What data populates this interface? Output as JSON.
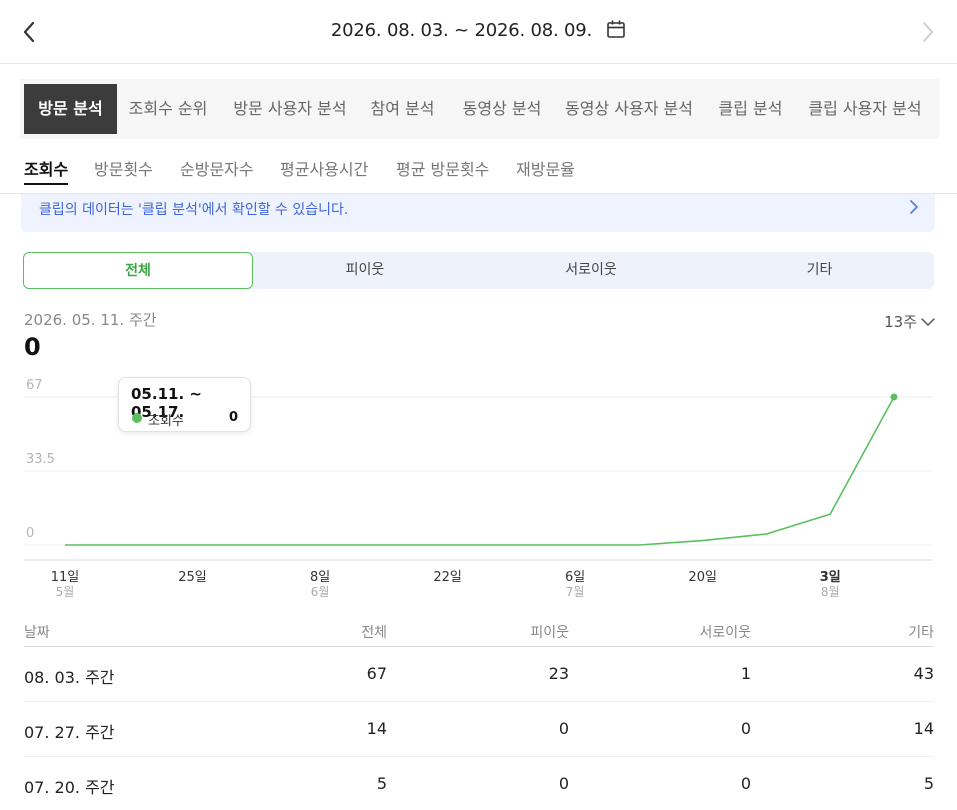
{
  "header": {
    "date_range": "2026. 08. 03. ~ 2026. 08. 09.",
    "icons": {
      "back": "chevron-left-icon",
      "next": "chevron-right-icon",
      "calendar": "calendar-icon"
    }
  },
  "main_tabs": [
    {
      "label": "방문 분석",
      "active": true
    },
    {
      "label": "조회수 순위",
      "active": false
    },
    {
      "label": "방문 사용자 분석",
      "active": false
    },
    {
      "label": "참여 분석",
      "active": false
    },
    {
      "label": "동영상 분석",
      "active": false
    },
    {
      "label": "동영상 사용자 분석",
      "active": false
    },
    {
      "label": "클립 분석",
      "active": false
    },
    {
      "label": "클립 사용자 분석",
      "active": false
    }
  ],
  "sub_tabs": [
    {
      "label": "조회수",
      "active": true
    },
    {
      "label": "방문횟수",
      "active": false
    },
    {
      "label": "순방문자수",
      "active": false
    },
    {
      "label": "평균사용시간",
      "active": false
    },
    {
      "label": "평균 방문횟수",
      "active": false
    },
    {
      "label": "재방문율",
      "active": false
    }
  ],
  "notice": {
    "text": "클립의 데이터는 '클립 분석'에서 확인할 수 있습니다."
  },
  "segments": [
    {
      "label": "전체",
      "active": true
    },
    {
      "label": "피이웃",
      "active": false
    },
    {
      "label": "서로이웃",
      "active": false
    },
    {
      "label": "기타",
      "active": false
    }
  ],
  "selected_period": {
    "label": "2026. 05. 11. 주간",
    "value": "0"
  },
  "weeks_select": {
    "label": "13주"
  },
  "tooltip": {
    "title": "05.11. ~ 05.17.",
    "series_label": "조회수",
    "value": "0"
  },
  "colors": {
    "accent_green": "#5bbf5f",
    "notice_blue": "#3f66d8",
    "active_tab_bg": "#3c3c3c"
  },
  "chart_data": {
    "type": "line",
    "series": [
      {
        "name": "조회수",
        "values": [
          0,
          0,
          0,
          0,
          0,
          0,
          0,
          0,
          0,
          0,
          2,
          5,
          14,
          67
        ]
      }
    ],
    "y_ticks": [
      "67",
      "33.5",
      "0"
    ],
    "ylim": [
      0,
      67
    ],
    "x_labels": [
      {
        "day": "11일",
        "month": "5월",
        "bold": false
      },
      {
        "day": "25일",
        "month": "",
        "bold": false
      },
      {
        "day": "8일",
        "month": "6월",
        "bold": false
      },
      {
        "day": "22일",
        "month": "",
        "bold": false
      },
      {
        "day": "6일",
        "month": "7월",
        "bold": false
      },
      {
        "day": "20일",
        "month": "",
        "bold": false
      },
      {
        "day": "3일",
        "month": "8월",
        "bold": true
      }
    ],
    "grid": true
  },
  "table": {
    "headers": [
      "날짜",
      "전체",
      "피이웃",
      "서로이웃",
      "기타"
    ],
    "rows": [
      [
        "08. 03. 주간",
        "67",
        "23",
        "1",
        "43"
      ],
      [
        "07. 27. 주간",
        "14",
        "0",
        "0",
        "14"
      ],
      [
        "07. 20. 주간",
        "5",
        "0",
        "0",
        "5"
      ]
    ]
  }
}
